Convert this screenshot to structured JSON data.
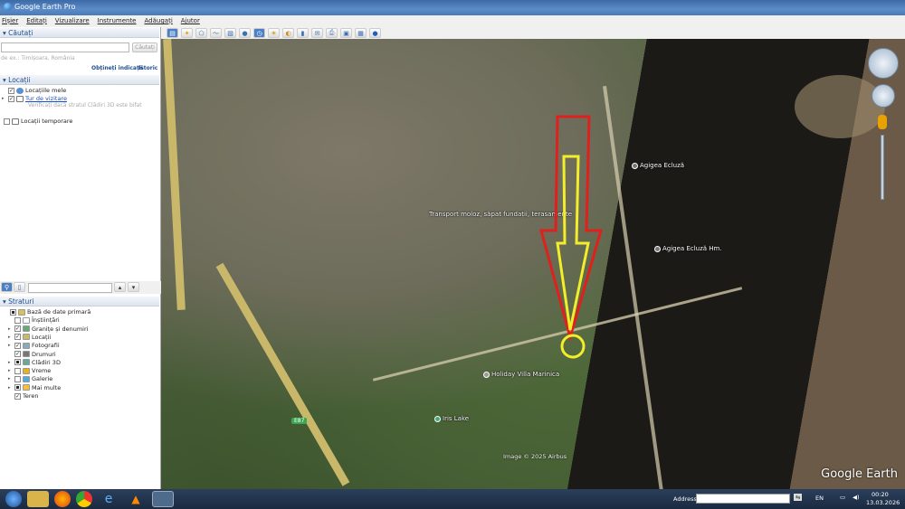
{
  "window": {
    "title": "Google Earth Pro"
  },
  "menu": [
    "Fișier",
    "Editați",
    "Vizualizare",
    "Instrumente",
    "Adăugați",
    "Ajutor"
  ],
  "search": {
    "header": "Căutați",
    "input_value": "",
    "button": "Căutați",
    "hint": "de ex.: Timișoara, România",
    "directions_link": "Obțineți indicații",
    "history_link": "Istoric"
  },
  "places": {
    "header": "Locații",
    "items": [
      {
        "label": "Locațiile mele",
        "checked": true
      },
      {
        "label": "Tur de vizitare",
        "checked": true,
        "link": true
      },
      {
        "label": "Verificați dacă stratul Clădiri 3D este bifat"
      },
      {
        "label": "Locații temporare",
        "checked": false
      }
    ]
  },
  "layers": {
    "header": "Straturi",
    "items": [
      {
        "label": "Bază de date primară",
        "state": "partial"
      },
      {
        "label": "Înștiințări",
        "state": "unchecked"
      },
      {
        "label": "Granițe și denumiri",
        "state": "checked"
      },
      {
        "label": "Locații",
        "state": "checked"
      },
      {
        "label": "Fotografii",
        "state": "checked"
      },
      {
        "label": "Drumuri",
        "state": "checked"
      },
      {
        "label": "Clădiri 3D",
        "state": "partial"
      },
      {
        "label": "Vreme",
        "state": "unchecked"
      },
      {
        "label": "Galerie",
        "state": "unchecked"
      },
      {
        "label": "Mai multe",
        "state": "partial"
      },
      {
        "label": "Teren",
        "state": "checked"
      }
    ]
  },
  "map": {
    "labels": [
      {
        "text": "Agigea Ecluză"
      },
      {
        "text": "Agigea Ecluză Hm."
      },
      {
        "text": "Transport moloz, săpat fundații, terasamente"
      },
      {
        "text": "Holiday Villa Marinica"
      },
      {
        "text": "Iris Lake"
      }
    ],
    "road_badge": "E87",
    "copyright": "Image © 2025 Airbus",
    "logo": "Google Earth",
    "annotation_colors": {
      "outer_arrow": "#e0201c",
      "inner_arrow": "#f2ee2a",
      "circle": "#f2ee2a"
    }
  },
  "taskbar": {
    "address_label": "Address",
    "address_value": "",
    "language": "EN",
    "time": "00:20",
    "date": "13.03.2026"
  }
}
